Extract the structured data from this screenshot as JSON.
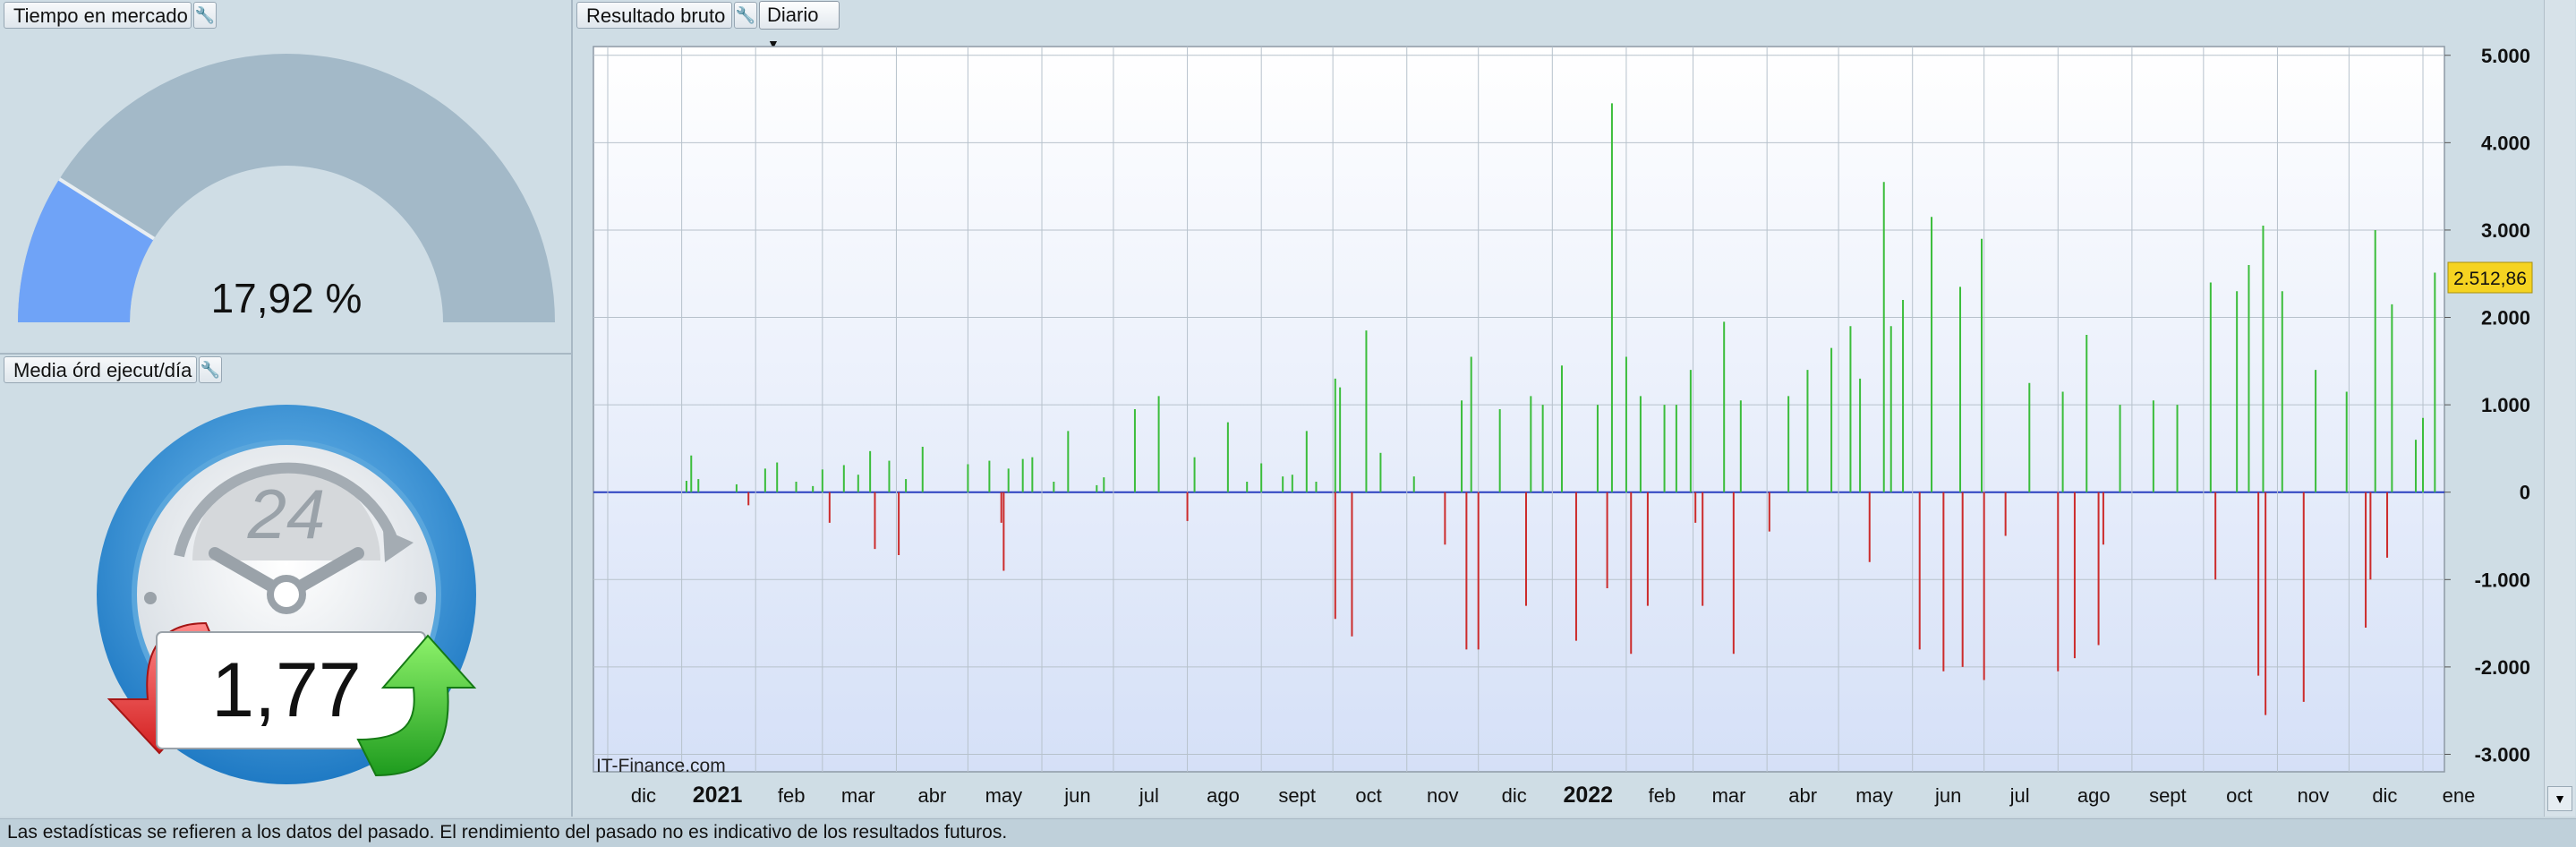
{
  "time_panel": {
    "title": "Tiempo en mercado",
    "value_text": "17,92 %",
    "fraction": 0.1792
  },
  "orders_panel": {
    "title": "Media órd ejecut/día",
    "value_text": "1,77",
    "clock_number": "24"
  },
  "result_panel": {
    "title": "Resultado bruto",
    "period": "Diario"
  },
  "watermark": "IT-Finance.com",
  "last_value_label": "2.512,86",
  "footer": "Las estadísticas se refieren a los datos del pasado. El rendimiento del pasado no es indicativo de los resultados futuros.",
  "colors": {
    "positive": "#3bbd3b",
    "negative": "#cc2b2b",
    "gauge_fill": "#6fa3f7",
    "gauge_track": "#a3b9c8",
    "zero_line": "#2a3fbf"
  },
  "chart_data": {
    "type": "bar",
    "x_range": [
      "2020-11-25",
      "2023-01-10"
    ],
    "ylim": [
      -3200,
      5100
    ],
    "yticks": [
      5000,
      4000,
      3000,
      2000,
      1000,
      0,
      -1000,
      -2000,
      -3000
    ],
    "ytick_labels": [
      "5.000",
      "4.000",
      "3.000",
      "2.000",
      "1.000",
      "0",
      "-1.000",
      "-2.000",
      "-3.000"
    ],
    "month_labels": [
      {
        "date": "2020-12-01",
        "label": "dic"
      },
      {
        "date": "2021-01-01",
        "label": "2021",
        "bold": true
      },
      {
        "date": "2021-02-01",
        "label": "feb"
      },
      {
        "date": "2021-03-01",
        "label": "mar"
      },
      {
        "date": "2021-04-01",
        "label": "abr"
      },
      {
        "date": "2021-05-01",
        "label": "may"
      },
      {
        "date": "2021-06-01",
        "label": "jun"
      },
      {
        "date": "2021-07-01",
        "label": "jul"
      },
      {
        "date": "2021-08-01",
        "label": "ago"
      },
      {
        "date": "2021-09-01",
        "label": "sept"
      },
      {
        "date": "2021-10-01",
        "label": "oct"
      },
      {
        "date": "2021-11-01",
        "label": "nov"
      },
      {
        "date": "2021-12-01",
        "label": "dic"
      },
      {
        "date": "2022-01-01",
        "label": "2022",
        "bold": true
      },
      {
        "date": "2022-02-01",
        "label": "feb"
      },
      {
        "date": "2022-03-01",
        "label": "mar"
      },
      {
        "date": "2022-04-01",
        "label": "abr"
      },
      {
        "date": "2022-05-01",
        "label": "may"
      },
      {
        "date": "2022-06-01",
        "label": "jun"
      },
      {
        "date": "2022-07-01",
        "label": "jul"
      },
      {
        "date": "2022-08-01",
        "label": "ago"
      },
      {
        "date": "2022-09-01",
        "label": "sept"
      },
      {
        "date": "2022-10-01",
        "label": "oct"
      },
      {
        "date": "2022-11-01",
        "label": "nov"
      },
      {
        "date": "2022-12-01",
        "label": "dic"
      },
      {
        "date": "2023-01-01",
        "label": "ene"
      }
    ],
    "bars": [
      {
        "date": "2021-01-03",
        "value": 130
      },
      {
        "date": "2021-01-05",
        "value": 420
      },
      {
        "date": "2021-01-08",
        "value": 150
      },
      {
        "date": "2021-01-24",
        "value": 90
      },
      {
        "date": "2021-01-29",
        "value": -150
      },
      {
        "date": "2021-02-05",
        "value": 270
      },
      {
        "date": "2021-02-10",
        "value": 340
      },
      {
        "date": "2021-02-18",
        "value": 120
      },
      {
        "date": "2021-02-25",
        "value": 70
      },
      {
        "date": "2021-03-01",
        "value": 260
      },
      {
        "date": "2021-03-04",
        "value": -350
      },
      {
        "date": "2021-03-10",
        "value": 310
      },
      {
        "date": "2021-03-16",
        "value": 200
      },
      {
        "date": "2021-03-21",
        "value": 470
      },
      {
        "date": "2021-03-23",
        "value": -650
      },
      {
        "date": "2021-03-29",
        "value": 360
      },
      {
        "date": "2021-04-02",
        "value": -720
      },
      {
        "date": "2021-04-05",
        "value": 150
      },
      {
        "date": "2021-04-12",
        "value": 520
      },
      {
        "date": "2021-05-01",
        "value": 320
      },
      {
        "date": "2021-05-10",
        "value": 360
      },
      {
        "date": "2021-05-15",
        "value": -350
      },
      {
        "date": "2021-05-16",
        "value": -900
      },
      {
        "date": "2021-05-18",
        "value": 270
      },
      {
        "date": "2021-05-24",
        "value": 380
      },
      {
        "date": "2021-05-28",
        "value": 400
      },
      {
        "date": "2021-06-06",
        "value": 120
      },
      {
        "date": "2021-06-12",
        "value": 700
      },
      {
        "date": "2021-06-24",
        "value": 80
      },
      {
        "date": "2021-06-27",
        "value": 170
      },
      {
        "date": "2021-07-10",
        "value": 950
      },
      {
        "date": "2021-07-20",
        "value": 1100
      },
      {
        "date": "2021-08-01",
        "value": -330
      },
      {
        "date": "2021-08-04",
        "value": 400
      },
      {
        "date": "2021-08-18",
        "value": 800
      },
      {
        "date": "2021-08-26",
        "value": 120
      },
      {
        "date": "2021-09-01",
        "value": 330
      },
      {
        "date": "2021-09-10",
        "value": 180
      },
      {
        "date": "2021-09-14",
        "value": 200
      },
      {
        "date": "2021-09-20",
        "value": 700
      },
      {
        "date": "2021-09-24",
        "value": 120
      },
      {
        "date": "2021-10-02",
        "value": 1300
      },
      {
        "date": "2021-10-02",
        "value": -1450
      },
      {
        "date": "2021-10-04",
        "value": 1200
      },
      {
        "date": "2021-10-09",
        "value": -1650
      },
      {
        "date": "2021-10-15",
        "value": 1850
      },
      {
        "date": "2021-10-21",
        "value": 450
      },
      {
        "date": "2021-11-04",
        "value": 180
      },
      {
        "date": "2021-11-17",
        "value": -600
      },
      {
        "date": "2021-11-24",
        "value": 1050
      },
      {
        "date": "2021-11-26",
        "value": -1800
      },
      {
        "date": "2021-11-28",
        "value": 1550
      },
      {
        "date": "2021-12-01",
        "value": -1800
      },
      {
        "date": "2021-12-10",
        "value": 950
      },
      {
        "date": "2021-12-21",
        "value": -1300
      },
      {
        "date": "2021-12-23",
        "value": 1100
      },
      {
        "date": "2021-12-28",
        "value": 1000
      },
      {
        "date": "2022-01-05",
        "value": 1450
      },
      {
        "date": "2022-01-11",
        "value": -1700
      },
      {
        "date": "2022-01-20",
        "value": 1000
      },
      {
        "date": "2022-01-24",
        "value": -1100
      },
      {
        "date": "2022-01-26",
        "value": 4450
      },
      {
        "date": "2022-02-01",
        "value": 1550
      },
      {
        "date": "2022-02-03",
        "value": -1850
      },
      {
        "date": "2022-02-07",
        "value": 1100
      },
      {
        "date": "2022-02-10",
        "value": -1300
      },
      {
        "date": "2022-02-17",
        "value": 1000
      },
      {
        "date": "2022-02-22",
        "value": 1000
      },
      {
        "date": "2022-02-28",
        "value": 1400
      },
      {
        "date": "2022-03-02",
        "value": -350
      },
      {
        "date": "2022-03-05",
        "value": -1300
      },
      {
        "date": "2022-03-14",
        "value": 1950
      },
      {
        "date": "2022-03-18",
        "value": -1850
      },
      {
        "date": "2022-03-21",
        "value": 1050
      },
      {
        "date": "2022-04-02",
        "value": -450
      },
      {
        "date": "2022-04-10",
        "value": 1100
      },
      {
        "date": "2022-04-18",
        "value": 1400
      },
      {
        "date": "2022-04-28",
        "value": 1650
      },
      {
        "date": "2022-05-06",
        "value": 1900
      },
      {
        "date": "2022-05-10",
        "value": 1300
      },
      {
        "date": "2022-05-14",
        "value": -800
      },
      {
        "date": "2022-05-20",
        "value": 3550
      },
      {
        "date": "2022-05-23",
        "value": 1900
      },
      {
        "date": "2022-05-28",
        "value": 2200
      },
      {
        "date": "2022-06-04",
        "value": -1800
      },
      {
        "date": "2022-06-09",
        "value": 3150
      },
      {
        "date": "2022-06-14",
        "value": -2050
      },
      {
        "date": "2022-06-21",
        "value": 2350
      },
      {
        "date": "2022-06-22",
        "value": -2000
      },
      {
        "date": "2022-06-30",
        "value": 2900
      },
      {
        "date": "2022-07-01",
        "value": -2150
      },
      {
        "date": "2022-07-10",
        "value": -500
      },
      {
        "date": "2022-07-20",
        "value": 1250
      },
      {
        "date": "2022-08-01",
        "value": -2050
      },
      {
        "date": "2022-08-03",
        "value": 1150
      },
      {
        "date": "2022-08-08",
        "value": -1900
      },
      {
        "date": "2022-08-13",
        "value": 1800
      },
      {
        "date": "2022-08-18",
        "value": -1750
      },
      {
        "date": "2022-08-20",
        "value": -600
      },
      {
        "date": "2022-08-27",
        "value": 1000
      },
      {
        "date": "2022-09-10",
        "value": 1050
      },
      {
        "date": "2022-09-20",
        "value": 1000
      },
      {
        "date": "2022-10-04",
        "value": 2400
      },
      {
        "date": "2022-10-06",
        "value": -1000
      },
      {
        "date": "2022-10-15",
        "value": 2300
      },
      {
        "date": "2022-10-20",
        "value": 2600
      },
      {
        "date": "2022-10-24",
        "value": -2100
      },
      {
        "date": "2022-10-26",
        "value": 3050
      },
      {
        "date": "2022-10-27",
        "value": -2550
      },
      {
        "date": "2022-11-03",
        "value": 2300
      },
      {
        "date": "2022-11-12",
        "value": -2400
      },
      {
        "date": "2022-11-17",
        "value": 1400
      },
      {
        "date": "2022-11-30",
        "value": 1150
      },
      {
        "date": "2022-12-08",
        "value": -1550
      },
      {
        "date": "2022-12-10",
        "value": -1000
      },
      {
        "date": "2022-12-12",
        "value": 3000
      },
      {
        "date": "2022-12-17",
        "value": -750
      },
      {
        "date": "2022-12-19",
        "value": 2150
      },
      {
        "date": "2022-12-29",
        "value": 600
      },
      {
        "date": "2023-01-01",
        "value": 850
      },
      {
        "date": "2023-01-06",
        "value": 2512.86
      }
    ]
  }
}
